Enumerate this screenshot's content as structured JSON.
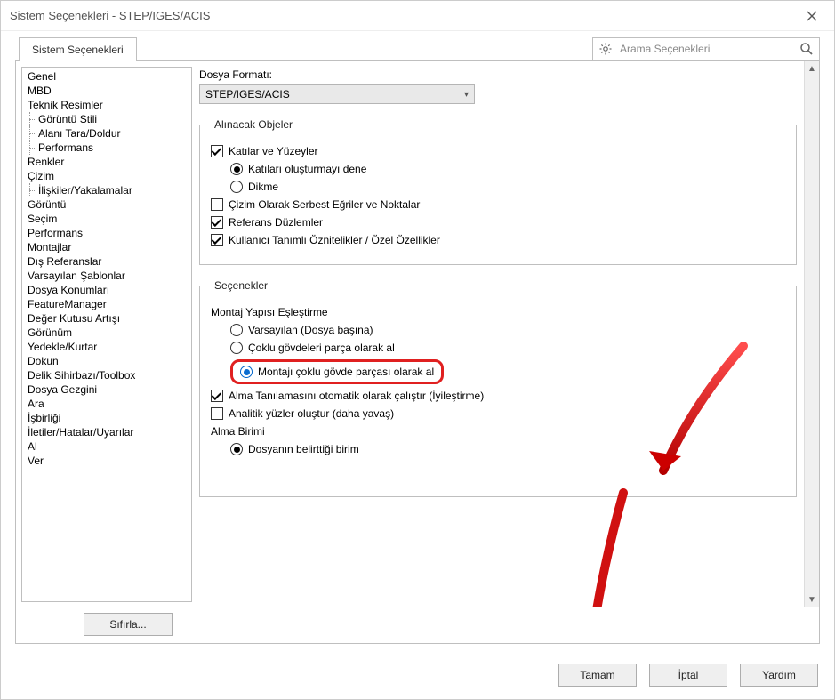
{
  "window": {
    "title": "Sistem Seçenekleri - STEP/IGES/ACIS"
  },
  "search": {
    "placeholder": "Arama Seçenekleri"
  },
  "tab": {
    "label": "Sistem Seçenekleri"
  },
  "sidebar": {
    "items": [
      {
        "label": "Genel"
      },
      {
        "label": "MBD"
      },
      {
        "label": "Teknik Resimler"
      },
      {
        "label": "Görüntü Stili",
        "child": true
      },
      {
        "label": "Alanı Tara/Doldur",
        "child": true
      },
      {
        "label": "Performans",
        "child": true
      },
      {
        "label": "Renkler"
      },
      {
        "label": "Çizim"
      },
      {
        "label": "İlişkiler/Yakalamalar",
        "child": true
      },
      {
        "label": "Görüntü"
      },
      {
        "label": "Seçim"
      },
      {
        "label": "Performans"
      },
      {
        "label": "Montajlar"
      },
      {
        "label": "Dış Referanslar"
      },
      {
        "label": "Varsayılan Şablonlar"
      },
      {
        "label": "Dosya Konumları"
      },
      {
        "label": "FeatureManager"
      },
      {
        "label": "Değer Kutusu Artışı"
      },
      {
        "label": "Görünüm"
      },
      {
        "label": "Yedekle/Kurtar"
      },
      {
        "label": "Dokun"
      },
      {
        "label": "Delik Sihirbazı/Toolbox"
      },
      {
        "label": "Dosya Gezgini"
      },
      {
        "label": "Ara"
      },
      {
        "label": "İşbirliği"
      },
      {
        "label": "İletiler/Hatalar/Uyarılar"
      },
      {
        "label": "Al"
      },
      {
        "label": "Ver"
      }
    ]
  },
  "main": {
    "format_label": "Dosya Formatı:",
    "format_value": "STEP/IGES/ACIS",
    "group_import": {
      "legend": "Alınacak Objeler",
      "solids_surfaces": "Katılar ve Yüzeyler",
      "try_form_solids": "Katıları oluşturmayı dene",
      "knit": "Dikme",
      "free_curves": "Çizim Olarak Serbest Eğriler ve Noktalar",
      "ref_planes": "Referans Düzlemler",
      "user_attrs": "Kullanıcı Tanımlı Öznitelikler / Özel Özellikler"
    },
    "group_options": {
      "legend": "Seçenekler",
      "map_heading": "Montaj Yapısı Eşleştirme",
      "default_per_file": "Varsayılan (Dosya başına)",
      "multi_as_parts": "Çoklu gövdeleri parça olarak al",
      "assembly_as_multibody": "Montajı çoklu gövde parçası olarak al",
      "auto_diag": "Alma Tanılamasını otomatik olarak çalıştır (İyileştirme)",
      "analytic": "Analitik yüzler oluştur (daha yavaş)",
      "unit_heading": "Alma Birimi",
      "unit_file": "Dosyanın belirttiği birim"
    }
  },
  "buttons": {
    "reset": "Sıfırla...",
    "ok": "Tamam",
    "cancel": "İptal",
    "help": "Yardım"
  }
}
